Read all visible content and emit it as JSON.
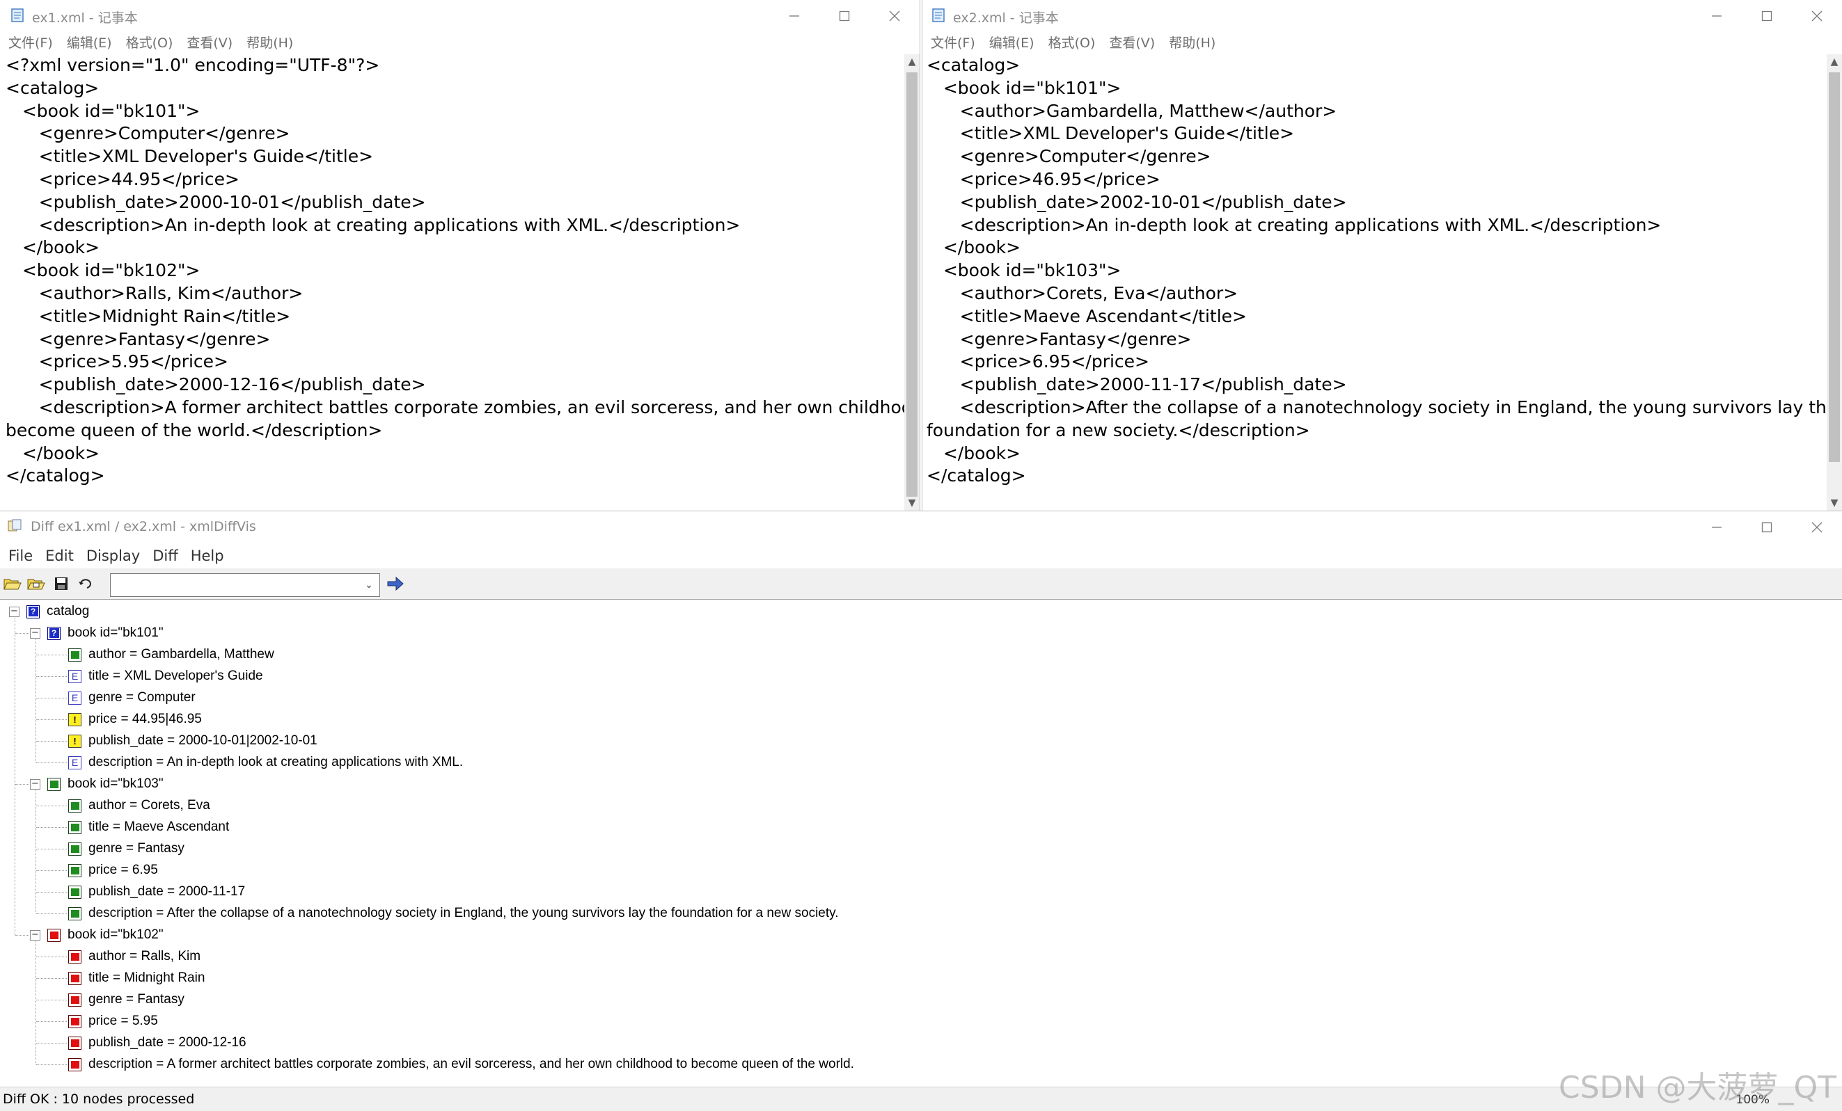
{
  "notepad_menu": [
    "文件(F)",
    "编辑(E)",
    "格式(O)",
    "查看(V)",
    "帮助(H)"
  ],
  "left": {
    "title": "ex1.xml - 记事本",
    "lines": [
      "<?xml version=\"1.0\" encoding=\"UTF-8\"?>",
      "<catalog>",
      "   <book id=\"bk101\">",
      "",
      "      <genre>Computer</genre>",
      "      <title>XML Developer's Guide</title>",
      "      <price>44.95</price>",
      "      <publish_date>2000-10-01</publish_date>",
      "      <description>An in-depth look at creating applications with XML.</description>",
      "   </book>",
      "   <book id=\"bk102\">",
      "      <author>Ralls, Kim</author>",
      "      <title>Midnight Rain</title>",
      "      <genre>Fantasy</genre>",
      "      <price>5.95</price>",
      "      <publish_date>2000-12-16</publish_date>",
      "      <description>A former architect battles corporate zombies, an evil sorceress, and her own childhood to",
      "become queen of the world.</description>",
      "   </book>",
      "</catalog>"
    ]
  },
  "right": {
    "title": "ex2.xml - 记事本",
    "lines": [
      "<catalog>",
      "   <book id=\"bk101\">",
      "      <author>Gambardella, Matthew</author>",
      "      <title>XML Developer's Guide</title>",
      "      <genre>Computer</genre>",
      "      <price>46.95</price>",
      "      <publish_date>2002-10-01</publish_date>",
      "      <description>An in-depth look at creating applications with XML.</description>",
      "   </book>",
      "   <book id=\"bk103\">",
      "      <author>Corets, Eva</author>",
      "      <title>Maeve Ascendant</title>",
      "      <genre>Fantasy</genre>",
      "      <price>6.95</price>",
      "      <publish_date>2000-11-17</publish_date>",
      "      <description>After the collapse of a nanotechnology society in England, the young survivors lay the",
      "foundation for a new society.</description>",
      "   </book>",
      "</catalog>"
    ]
  },
  "diff": {
    "title": "Diff ex1.xml / ex2.xml  - xmlDiffVis",
    "menu": [
      "File",
      "Edit",
      "Display",
      "Diff",
      "Help"
    ],
    "combo_value": "",
    "root": "catalog",
    "books": [
      {
        "label": "book id=\"bk101\"",
        "status": "changed",
        "children": [
          {
            "text": "author = Gambardella, Matthew",
            "status": "added"
          },
          {
            "text": "title = XML Developer's Guide",
            "status": "equal"
          },
          {
            "text": "genre = Computer",
            "status": "equal"
          },
          {
            "text": "price = 44.95|46.95",
            "status": "modified"
          },
          {
            "text": "publish_date = 2000-10-01|2002-10-01",
            "status": "modified"
          },
          {
            "text": "description = An in-depth look at creating applications with XML.",
            "status": "equal"
          }
        ]
      },
      {
        "label": "book id=\"bk103\"",
        "status": "added",
        "children": [
          {
            "text": "author = Corets, Eva",
            "status": "added"
          },
          {
            "text": "title = Maeve Ascendant",
            "status": "added"
          },
          {
            "text": "genre = Fantasy",
            "status": "added"
          },
          {
            "text": "price = 6.95",
            "status": "added"
          },
          {
            "text": "publish_date = 2000-11-17",
            "status": "added"
          },
          {
            "text": "description = After the collapse of a nanotechnology society in England, the young survivors lay the foundation for a new society.",
            "status": "added"
          }
        ]
      },
      {
        "label": "book id=\"bk102\"",
        "status": "removed",
        "children": [
          {
            "text": "author = Ralls, Kim",
            "status": "removed"
          },
          {
            "text": "title = Midnight Rain",
            "status": "removed"
          },
          {
            "text": "genre = Fantasy",
            "status": "removed"
          },
          {
            "text": "price = 5.95",
            "status": "removed"
          },
          {
            "text": "publish_date = 2000-12-16",
            "status": "removed"
          },
          {
            "text": "description = A former architect battles corporate zombies, an evil sorceress, and her own childhood to become queen of the world.",
            "status": "removed"
          }
        ]
      }
    ],
    "status_text": "Diff OK : 10 nodes processed",
    "zoom": "100%"
  },
  "watermark": "CSDN @大菠萝_QT"
}
